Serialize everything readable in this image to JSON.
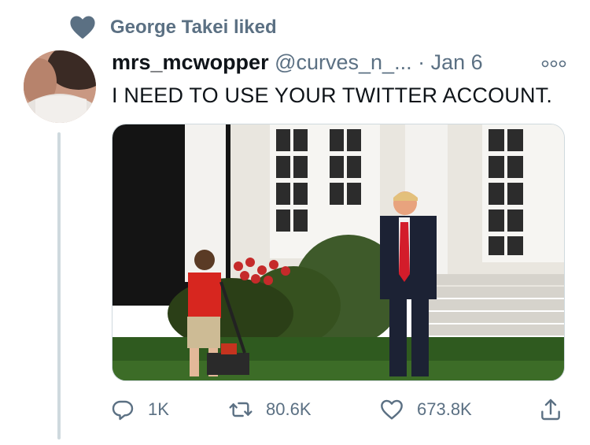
{
  "context": {
    "liked_text": "George Takei liked"
  },
  "tweet": {
    "display_name": "mrs_mcwopper",
    "handle": "@curves_n_...",
    "separator": "·",
    "date": "Jan 6",
    "text": "I NEED TO USE YOUR TWITTER ACCOUNT.",
    "media": {
      "alt": ""
    }
  },
  "actions": {
    "reply_count": "1K",
    "retweet_count": "80.6K",
    "like_count": "673.8K"
  },
  "icons": {
    "liked_indicator": "heart-icon",
    "more": "more-icon",
    "reply": "reply-icon",
    "retweet": "retweet-icon",
    "like": "like-icon",
    "share": "share-icon"
  },
  "colors": {
    "secondary_text": "#5b7083",
    "line": "#cfd9de",
    "liked_heart": "#5b7083"
  }
}
